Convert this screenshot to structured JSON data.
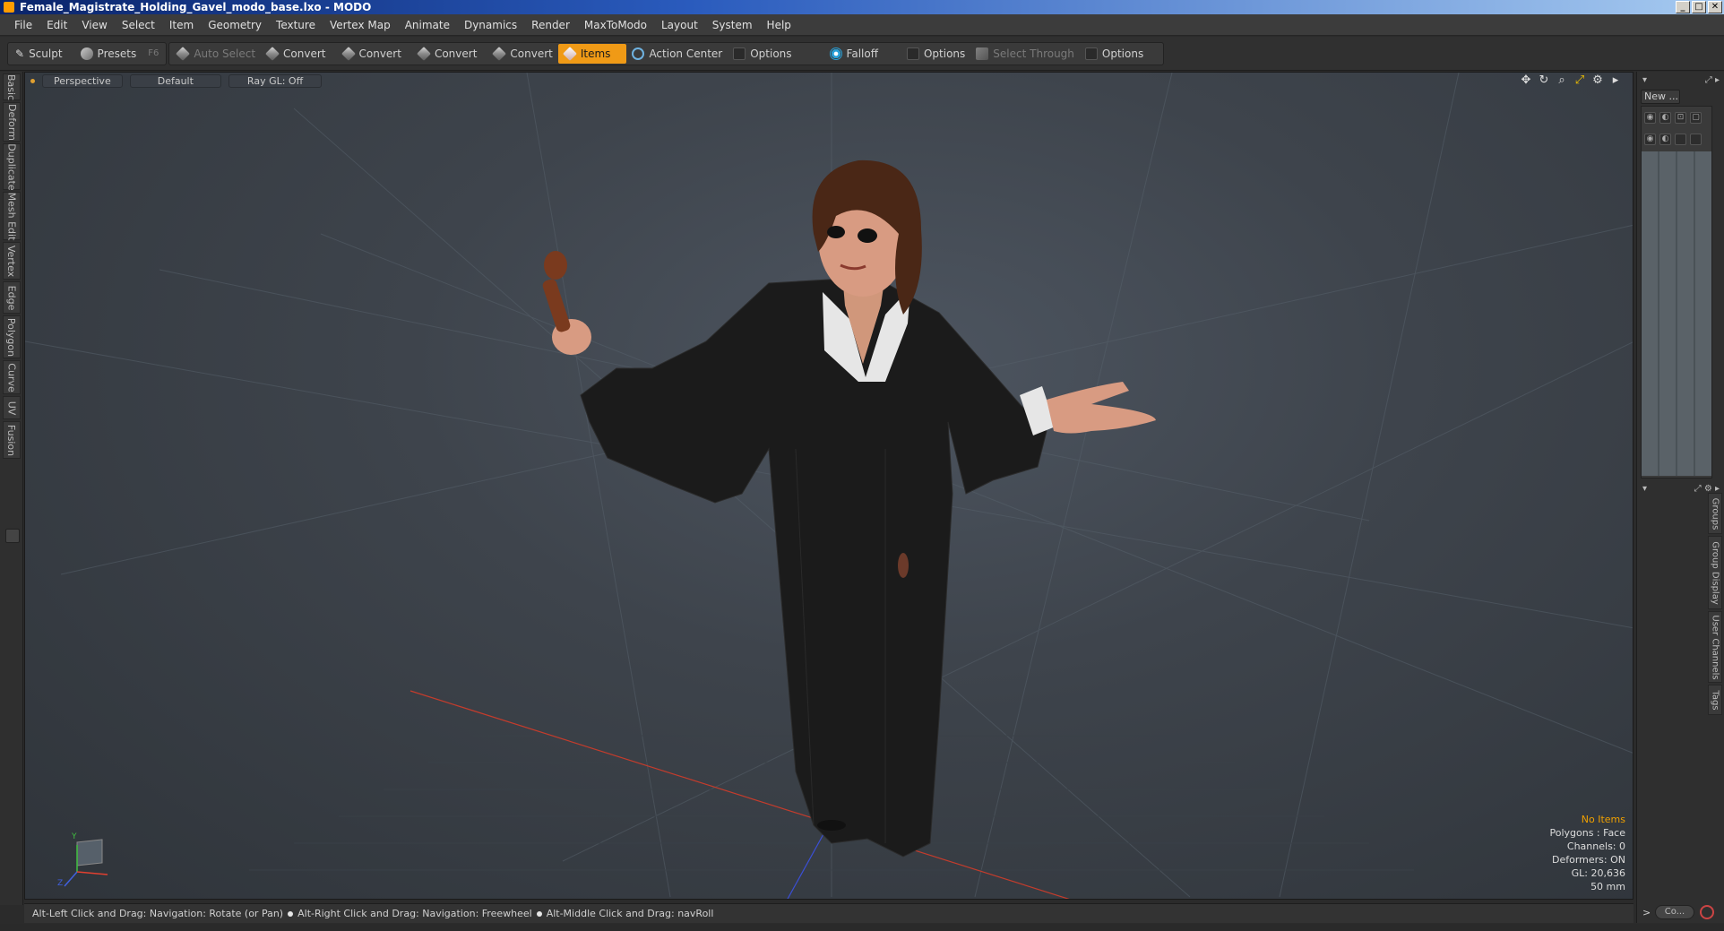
{
  "window": {
    "title": "Female_Magistrate_Holding_Gavel_modo_base.lxo - MODO",
    "minimize": "_",
    "maximize": "□",
    "close": "✕"
  },
  "menu": [
    "File",
    "Edit",
    "View",
    "Select",
    "Item",
    "Geometry",
    "Texture",
    "Vertex Map",
    "Animate",
    "Dynamics",
    "Render",
    "MaxToModo",
    "Layout",
    "System",
    "Help"
  ],
  "toolbar": {
    "sculpt": "Sculpt",
    "presets": "Presets",
    "presets_shortcut": "F6",
    "auto_select": "Auto Select",
    "convert1": "Convert",
    "convert2": "Convert",
    "convert3": "Convert",
    "convert4": "Convert",
    "items": "Items",
    "action_center": "Action Center",
    "options1": "Options",
    "falloff": "Falloff",
    "options2": "Options",
    "select_through": "Select Through",
    "options3": "Options"
  },
  "left_tabs": [
    "Basic",
    "Deform",
    "Duplicate",
    "Mesh Edit",
    "Vertex",
    "Edge",
    "Polygon",
    "Curve",
    "UV",
    "Fusion"
  ],
  "viewport": {
    "view": "Perspective",
    "shading": "Default",
    "raygl": "Ray GL: Off",
    "axis_y": "Y",
    "axis_z": "Z"
  },
  "info": {
    "items": "No Items",
    "polygons": "Polygons : Face",
    "channels": "Channels: 0",
    "deformers": "Deformers: ON",
    "gl": "GL: 20,636",
    "lens": "50 mm"
  },
  "status": {
    "hint1": "Alt-Left Click and Drag: Navigation: Rotate (or Pan)",
    "hint2": "Alt-Right Click and Drag: Navigation: Freewheel",
    "hint3": "Alt-Middle Click and Drag: navRoll"
  },
  "right_panel": {
    "new_button": "New ...",
    "tabs": [
      "Groups",
      "Group Display",
      "User Channels",
      "Tags"
    ],
    "command_button": "Co...",
    "chevron": ">"
  },
  "colors": {
    "accent": "#f09a16",
    "viewport_bg": "#3e444c",
    "x_axis": "#e04030",
    "z_axis": "#3050e0",
    "warning": "#f0a000"
  }
}
